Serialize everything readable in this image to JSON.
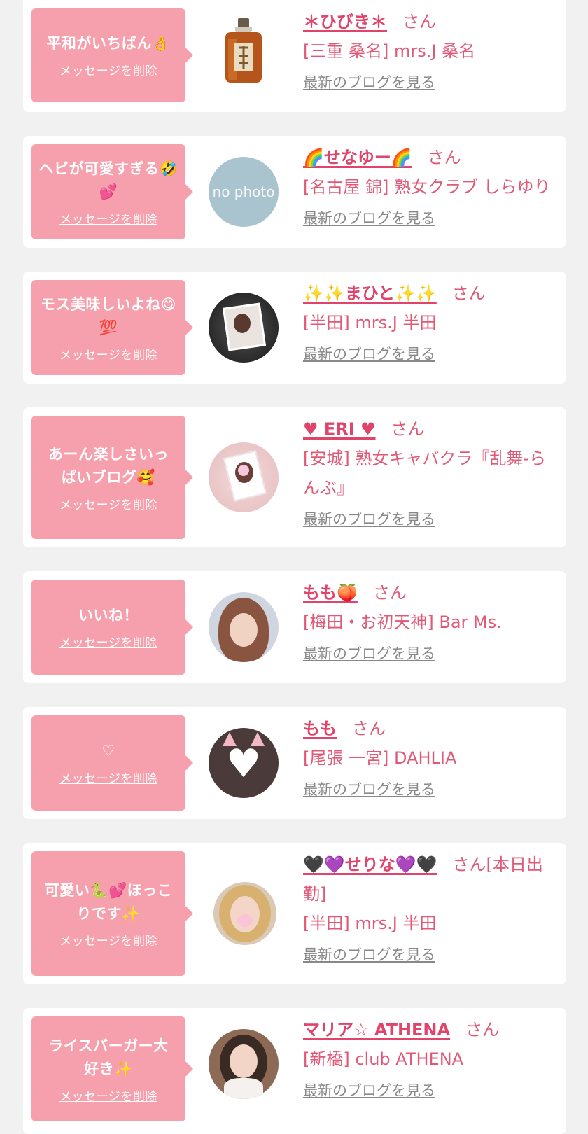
{
  "delete_label": "メッセージを削除",
  "blog_label": "最新のブログを見る",
  "san_label": "さん",
  "items": [
    {
      "message": "平和がいちばん👌",
      "name": "＊ひびき＊",
      "suffix": "さん",
      "shop": "[三重 桑名] mrs.J 桑名"
    },
    {
      "message": "ヘビが可愛すぎる🤣💕",
      "name": "🌈せなゆー🌈",
      "suffix": "さん",
      "shop": "[名古屋 錦] 熟女クラブ しらゆり",
      "avatar_text": "no photo"
    },
    {
      "message": "モス美味しいよね😋💯",
      "name": "✨✨まひと✨✨",
      "suffix": "さん",
      "shop": "[半田] mrs.J 半田"
    },
    {
      "message": "あーん楽しさいっぱいブログ🥰",
      "name": "♥ ERI ♥",
      "suffix": "さん",
      "shop": "[安城] 熟女キャバクラ『乱舞-らんぶ』"
    },
    {
      "message": "いいね！",
      "name": "もも🍑",
      "suffix": "さん",
      "shop": "[梅田・お初天神] Bar Ms."
    },
    {
      "message": "♡",
      "name": "もも",
      "suffix": "さん",
      "shop": "[尾張 一宮] DAHLIA"
    },
    {
      "message": "可愛い🐍💕ほっこりです✨",
      "name": "🖤💜せりな💜🖤",
      "suffix": "さん[本日出勤]",
      "shop": "[半田] mrs.J 半田"
    },
    {
      "message": "ライスバーガー大好き✨",
      "name": "マリア☆ ATHENA",
      "suffix": "さん",
      "shop": "[新橋] club ATHENA"
    }
  ]
}
